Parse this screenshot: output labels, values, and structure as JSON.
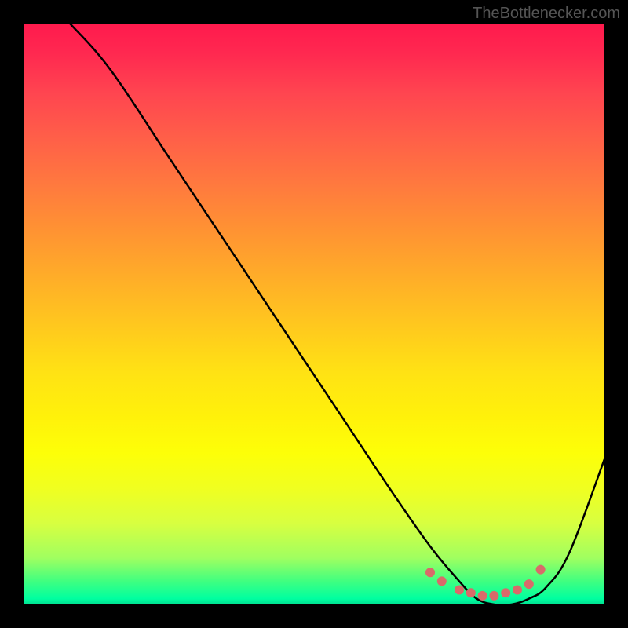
{
  "watermark": "TheBottlenecker.com",
  "chart_data": {
    "type": "line",
    "title": "",
    "xlabel": "",
    "ylabel": "",
    "xlim": [
      0,
      100
    ],
    "ylim": [
      0,
      100
    ],
    "series": [
      {
        "name": "curve",
        "x": [
          8,
          15,
          25,
          35,
          45,
          55,
          63,
          70,
          75,
          78,
          81,
          84,
          87,
          90,
          94,
          100
        ],
        "y": [
          100,
          92,
          77,
          62,
          47,
          32,
          20,
          10,
          4,
          1,
          0,
          0,
          1,
          3,
          9,
          25
        ]
      }
    ],
    "markers": {
      "name": "highlighted-points",
      "color": "#d96a6a",
      "x": [
        70,
        72,
        75,
        77,
        79,
        81,
        83,
        85,
        87,
        89
      ],
      "y": [
        5.5,
        4,
        2.5,
        2,
        1.5,
        1.5,
        2,
        2.5,
        3.5,
        6
      ]
    }
  }
}
